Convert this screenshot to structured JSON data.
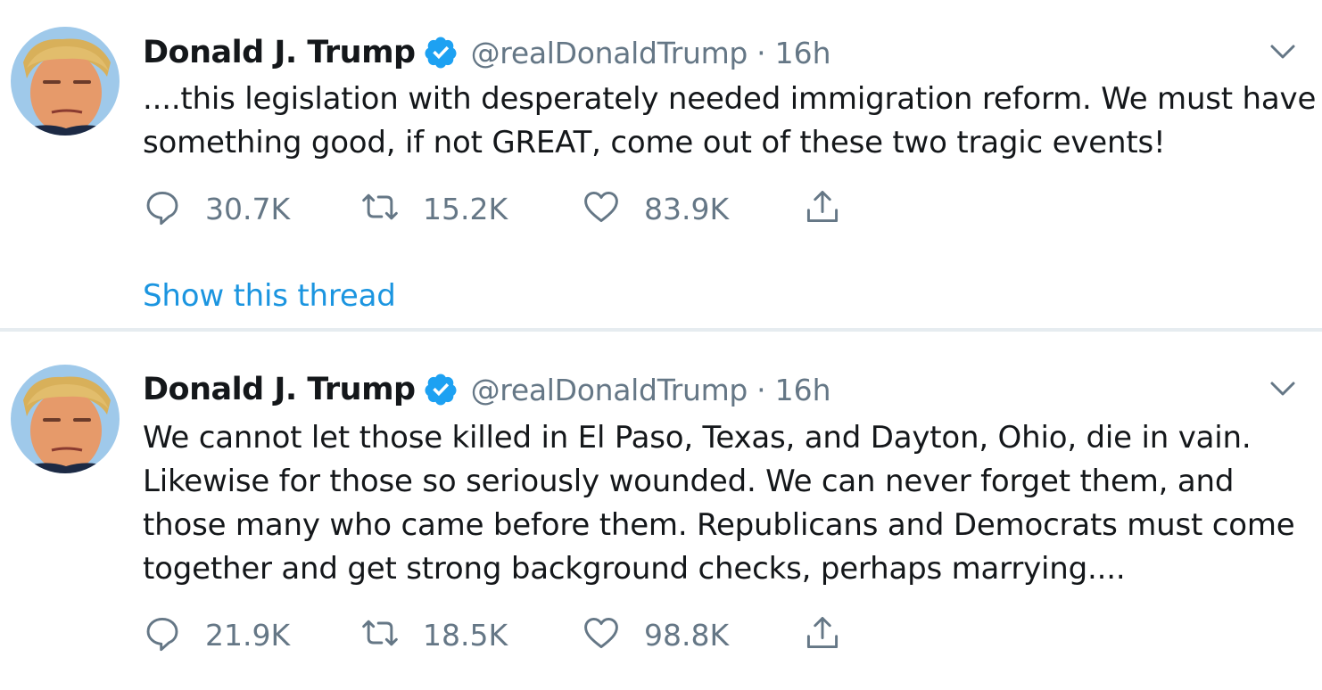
{
  "tweets": [
    {
      "author_name": "Donald J. Trump",
      "handle": "@realDonaldTrump",
      "separator": "·",
      "time": "16h",
      "verified": true,
      "text_lines": [
        "....this legislation with desperately needed immigration reform. We must have",
        "something good, if not GREAT, come out of these two tragic events!"
      ],
      "replies": "30.7K",
      "retweets": "15.2K",
      "likes": "83.9K",
      "thread_link": "Show this thread"
    },
    {
      "author_name": "Donald J. Trump",
      "handle": "@realDonaldTrump",
      "separator": "·",
      "time": "16h",
      "verified": true,
      "text_lines": [
        "We cannot let those killed in El Paso, Texas, and Dayton, Ohio, die in vain.",
        "Likewise for those so seriously wounded. We can never forget them, and",
        "those many who came before them. Republicans and Democrats must come",
        "together and get strong background checks, perhaps marrying...."
      ],
      "replies": "21.9K",
      "retweets": "18.5K",
      "likes": "98.8K"
    }
  ],
  "icons": {
    "reply": "speech-bubble-icon",
    "retweet": "retweet-arrows-icon",
    "like": "heart-icon",
    "share": "share-upload-icon",
    "verified": "verified-badge-icon",
    "caret": "chevron-down-icon"
  },
  "colors": {
    "verified_blue": "#1da1f2",
    "link_blue": "#1b95e0",
    "muted_gray": "#657786",
    "divider": "#e6ecf0"
  }
}
